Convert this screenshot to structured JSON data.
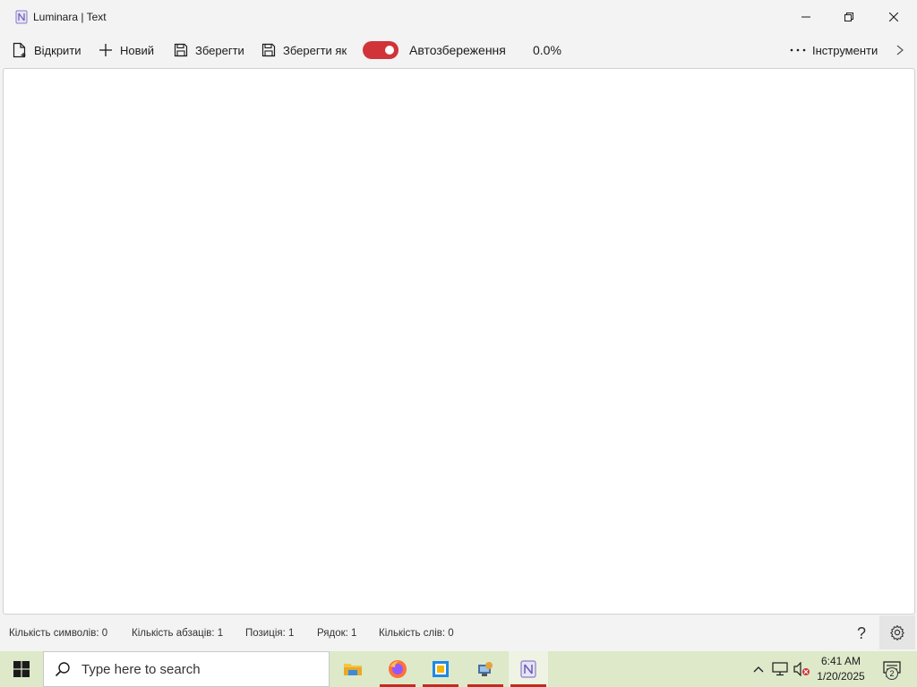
{
  "window": {
    "title": "Luminara | Text"
  },
  "toolbar": {
    "open_label": "Відкрити",
    "new_label": "Новий",
    "save_label": "Зберегти",
    "save_as_label": "Зберегти як",
    "autosave_label": "Автозбереження",
    "autosave_enabled": true,
    "progress_text": "0.0%",
    "tools_label": "Інструменти"
  },
  "editor": {
    "content": ""
  },
  "statusbar": {
    "char_count": "Кількість символів: 0",
    "paragraph_count": "Кількість абзаців: 1",
    "position": "Позиція: 1",
    "line": "Рядок: 1",
    "word_count": "Кількість слів: 0",
    "help_glyph": "?"
  },
  "taskbar": {
    "search_placeholder": "Type here to search",
    "apps": [
      "file-explorer",
      "firefox",
      "virtualbox",
      "network-app",
      "luminara"
    ],
    "time": "6:41 AM",
    "date": "1/20/2025",
    "notification_count": "2"
  },
  "colors": {
    "accent": "#d13438",
    "taskbar_bg": "#dde9c9",
    "window_bg": "#f3f3f3",
    "editor_bg": "#ffffff"
  }
}
